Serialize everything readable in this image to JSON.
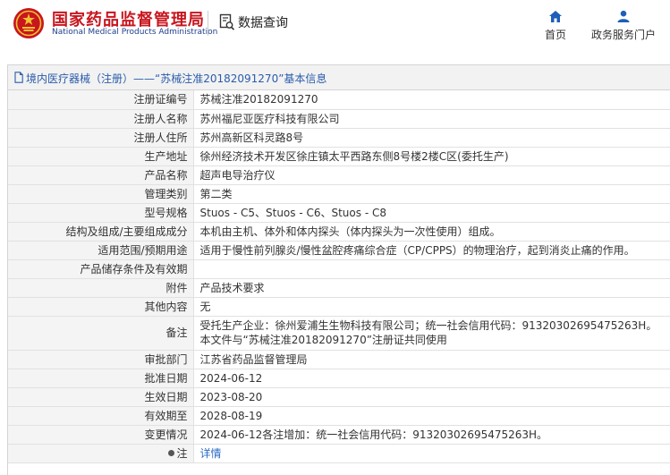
{
  "header": {
    "brand_cn": "国家药品监督管理局",
    "brand_en": "National Medical Products Administration",
    "section_title": "数据查询",
    "nav": {
      "home": "首页",
      "portal": "政务服务门户"
    },
    "logo_color": "#c8161e",
    "accent": "#1d5fb8"
  },
  "panel": {
    "title": "境内医疗器械（注册）——“苏械注准20182091270”基本信息",
    "rows": [
      {
        "label": "注册证编号",
        "value": "苏械注准20182091270"
      },
      {
        "label": "注册人名称",
        "value": "苏州福尼亚医疗科技有限公司"
      },
      {
        "label": "注册人住所",
        "value": "苏州高新区科灵路8号"
      },
      {
        "label": "生产地址",
        "value": "徐州经济技术开发区徐庄镇太平西路东侧8号楼2楼C区(委托生产)"
      },
      {
        "label": "产品名称",
        "value": "超声电导治疗仪"
      },
      {
        "label": "管理类别",
        "value": "第二类"
      },
      {
        "label": "型号规格",
        "value": "Stuos - C5、Stuos - C6、Stuos - C8"
      },
      {
        "label": "结构及组成/主要组成成分",
        "value": "本机由主机、体外和体内探头（体内探头为一次性使用）组成。"
      },
      {
        "label": "适用范围/预期用途",
        "value": "适用于慢性前列腺炎/慢性盆腔疼痛综合症（CP/CPPS）的物理治疗，起到消炎止痛的作用。"
      },
      {
        "label": "产品储存条件及有效期",
        "value": ""
      },
      {
        "label": "附件",
        "value": "产品技术要求"
      },
      {
        "label": "其他内容",
        "value": "无"
      },
      {
        "label": "备注",
        "value": "受托生产企业：徐州爱浦生生物科技有限公司；统一社会信用代码：91320302695475263H。本文件与“苏械注准20182091270”注册证共同使用"
      },
      {
        "label": "审批部门",
        "value": "江苏省药品监督管理局"
      },
      {
        "label": "批准日期",
        "value": "2024-06-12"
      },
      {
        "label": "生效日期",
        "value": "2023-08-20"
      },
      {
        "label": "有效期至",
        "value": "2028-08-19"
      },
      {
        "label": "变更情况",
        "value": "2024-06-12各注增加：统一社会信用代码：91320302695475263H。"
      }
    ],
    "note": {
      "label": "注",
      "link": "详情"
    }
  }
}
